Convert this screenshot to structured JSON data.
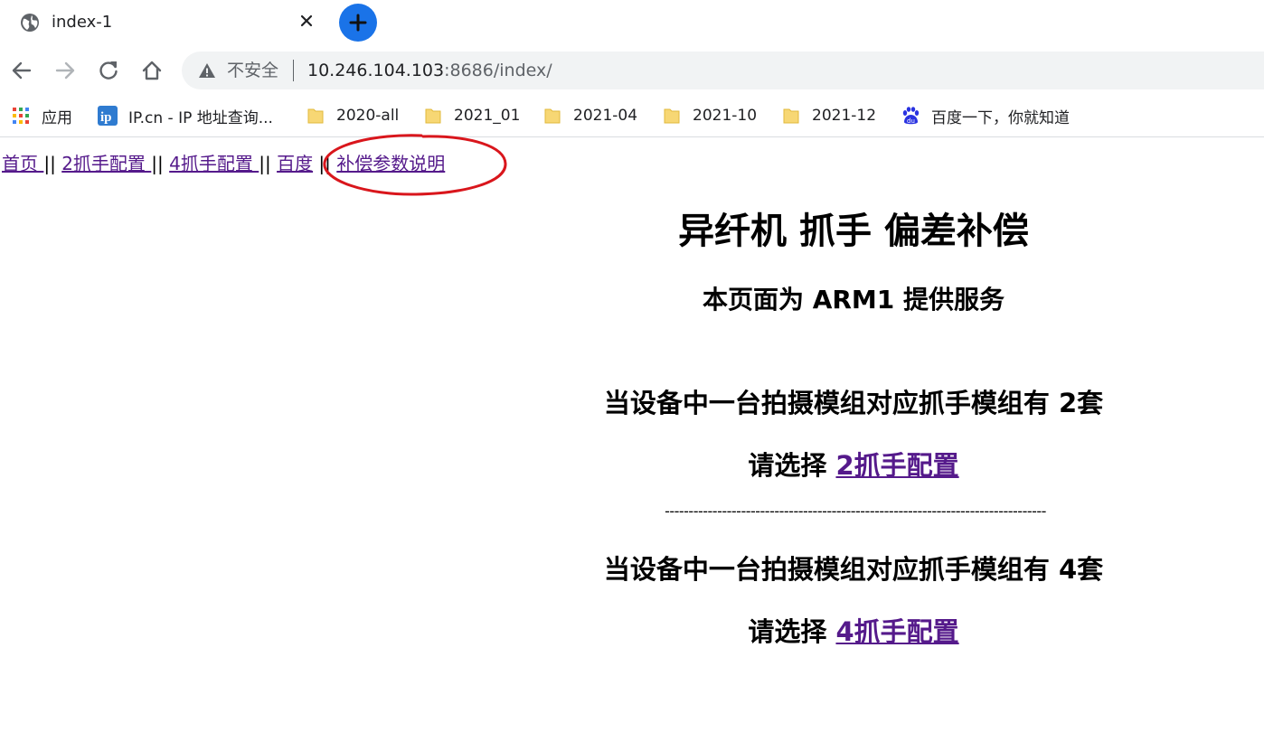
{
  "browser": {
    "tab": {
      "title": "index-1",
      "favicon": "globe-icon",
      "close": "close-icon"
    },
    "new_tab": "plus-icon",
    "toolbar": {
      "back": "arrow-left-icon",
      "forward": "arrow-right-icon",
      "reload": "reload-icon",
      "home": "home-icon"
    },
    "omnibox": {
      "security_icon": "warning-triangle-icon",
      "security_label": "不安全",
      "url_host": "10.246.104.103",
      "url_rest": ":8686/index/"
    },
    "bookmarks": [
      {
        "label": "应用",
        "icon": "apps-grid-icon"
      },
      {
        "label": "IP.cn - IP 地址查询...",
        "icon": "ip-logo-icon"
      },
      {
        "label": "2020-all",
        "icon": "folder-icon"
      },
      {
        "label": "2021_01",
        "icon": "folder-icon"
      },
      {
        "label": "2021-04",
        "icon": "folder-icon"
      },
      {
        "label": "2021-10",
        "icon": "folder-icon"
      },
      {
        "label": "2021-12",
        "icon": "folder-icon"
      },
      {
        "label": "百度一下，你就知道",
        "icon": "baidu-paw-icon"
      }
    ]
  },
  "page": {
    "nav": {
      "home": "首页 ",
      "sep1": "||",
      "two_gripper": "2抓手配置 ",
      "sep2": "||",
      "four_gripper": "4抓手配置 ",
      "sep3": "||",
      "baidu": "百度",
      "sep4": " || ",
      "comp_params": "补偿参数说明"
    },
    "title": "异纤机 抓手 偏差补偿",
    "subtitle": "本页面为 ARM1 提供服务",
    "section1": {
      "desc": "当设备中一台拍摄模组对应抓手模组有 2套",
      "prompt": "请选择 ",
      "link": "2抓手配置"
    },
    "divider": "--------------------------------------------------------------------------------",
    "section2": {
      "desc": "当设备中一台拍摄模组对应抓手模组有 4套",
      "prompt": "请选择 ",
      "link": "4抓手配置"
    },
    "annotation_color": "#d9161c",
    "link_color": "#551a8b"
  }
}
